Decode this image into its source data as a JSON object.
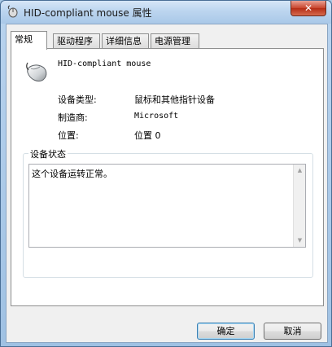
{
  "window": {
    "title": "HID-compliant mouse 属性",
    "close_label": "✕"
  },
  "tabs": [
    {
      "label": "常规",
      "active": true
    },
    {
      "label": "驱动程序",
      "active": false
    },
    {
      "label": "详细信息",
      "active": false
    },
    {
      "label": "电源管理",
      "active": false
    }
  ],
  "device": {
    "name": "HID-compliant mouse",
    "icon": "mouse-icon"
  },
  "properties": [
    {
      "label": "设备类型:",
      "value": "鼠标和其他指针设备"
    },
    {
      "label": "制造商:",
      "value": "Microsoft"
    },
    {
      "label": "位置:",
      "value": "位置 0"
    }
  ],
  "device_status": {
    "title": "设备状态",
    "text": "这个设备运转正常。"
  },
  "buttons": {
    "ok": "确定",
    "cancel": "取消"
  }
}
